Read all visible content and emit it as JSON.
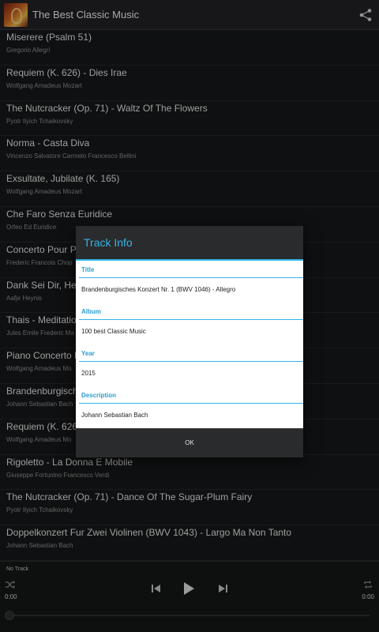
{
  "app": {
    "title": "The Best Classic Music"
  },
  "tracks": [
    {
      "title": "Miserere (Psalm 51)",
      "artist": "Gregorio Allegri"
    },
    {
      "title": "Requiem (K. 626) - Dies Irae",
      "artist": "Wolfgang Amadeus Mozart"
    },
    {
      "title": "The Nutcracker (Op. 71) - Waltz Of The Flowers",
      "artist": "Pyotr Ilyich Tchaikovsky"
    },
    {
      "title": "Norma - Casta Diva",
      "artist": "Vincenzo Salvatore Carmelo Francesco Bellini"
    },
    {
      "title": "Exsultate, Jubilate (K. 165)",
      "artist": "Wolfgang Amadeus Mozart"
    },
    {
      "title": "Che Faro Senza Euridice",
      "artist": "Orfeo Ed Euridice"
    },
    {
      "title": "Concerto Pour Pia",
      "artist": "Frederic Francois Chop"
    },
    {
      "title": "Dank Sei Dir, Herr",
      "artist": "Aafje Heynis"
    },
    {
      "title": "Thais - Meditation",
      "artist": "Jules Emile Frederic Ma"
    },
    {
      "title": "Piano Concerto No",
      "artist": "Wolfgang Amadeus Mo"
    },
    {
      "title": "Brandenburgische",
      "artist": "Johann Sebastian Bach"
    },
    {
      "title": "Requiem (K. 626)",
      "artist": "Wolfgang Amadeus Mo"
    },
    {
      "title": "Rigoletto - La Donna E Mobile",
      "artist": "Giuseppe Fortunino Francesco Verdi"
    },
    {
      "title": "The Nutcracker (Op. 71) - Dance Of The Sugar-Plum Fairy",
      "artist": "Pyotr Ilyich Tchaikovsky"
    },
    {
      "title": "Doppelkonzert Fur Zwei Violinen (BWV 1043) - Largo Ma Non Tanto",
      "artist": "Johann Sebastian Bach"
    }
  ],
  "dialog": {
    "title": "Track Info",
    "fields": [
      {
        "label": "Title",
        "value": "Brandenburgisches Konzert Nr. 1 (BWV 1046) - Allegro"
      },
      {
        "label": "Album",
        "value": "100 best Classic Music"
      },
      {
        "label": "Year",
        "value": "2015"
      },
      {
        "label": "Description",
        "value": "Johann Sebastian Bach"
      }
    ],
    "ok_label": "OK"
  },
  "player": {
    "now_playing": "No Track",
    "elapsed": "0:00",
    "duration": "0:00",
    "progress": 0
  },
  "colors": {
    "accent": "#33b5e5",
    "background": "#161718"
  },
  "icons": {
    "share": "share-icon",
    "shuffle": "shuffle-icon",
    "repeat": "repeat-icon",
    "prev": "skip-previous-icon",
    "play": "play-icon",
    "next": "skip-next-icon"
  }
}
